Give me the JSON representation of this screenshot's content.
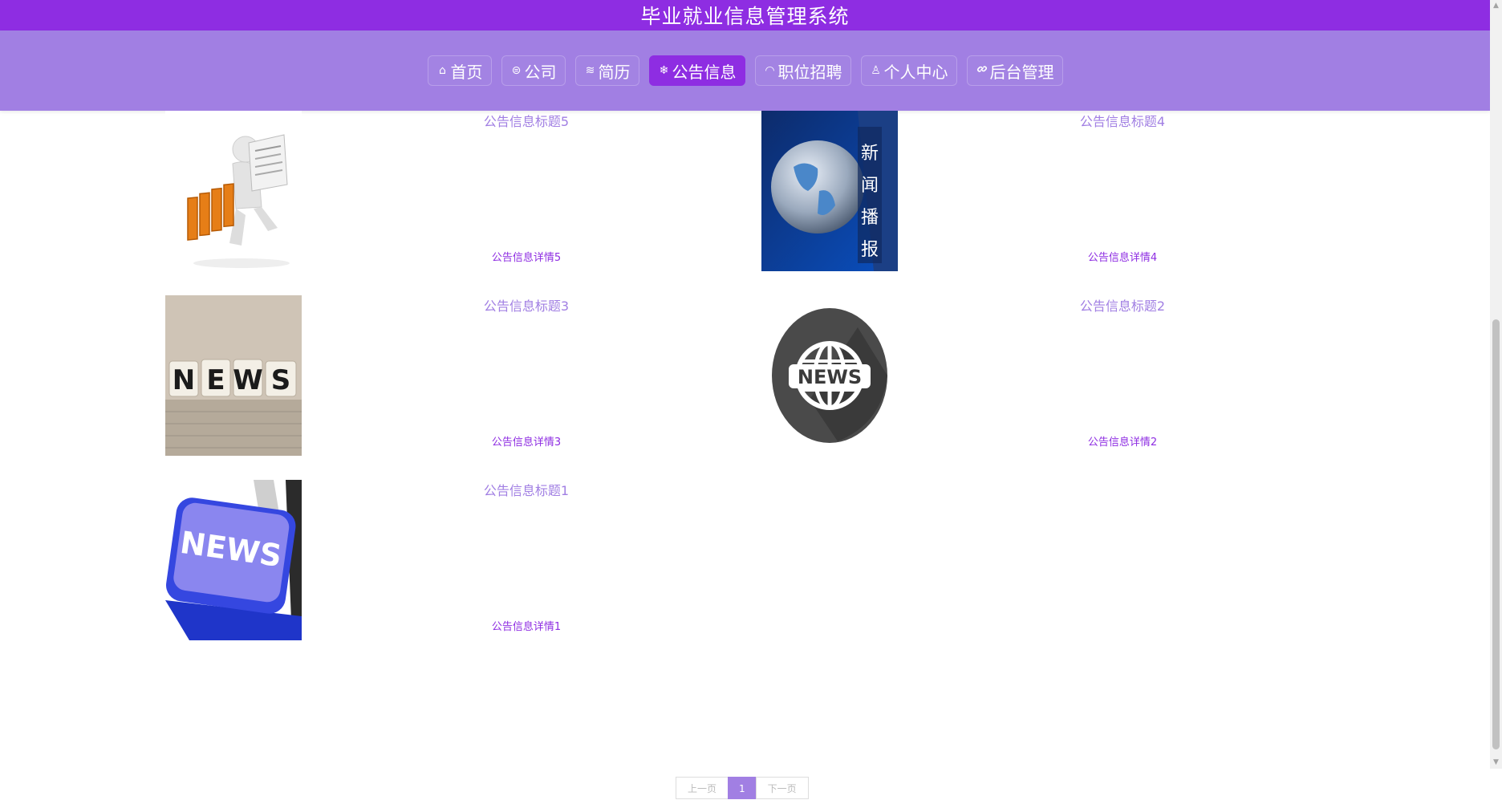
{
  "header": {
    "title": "毕业就业信息管理系统"
  },
  "nav": {
    "items": [
      {
        "icon": "home-icon",
        "glyph": "⌂",
        "label": "首页"
      },
      {
        "icon": "company-icon",
        "glyph": "⊜",
        "label": "公司"
      },
      {
        "icon": "layers-icon",
        "glyph": "≋",
        "label": "简历"
      },
      {
        "icon": "snowflake-icon",
        "glyph": "❄",
        "label": "公告信息",
        "active": true
      },
      {
        "icon": "briefcase-icon",
        "glyph": "◠",
        "label": "职位招聘"
      },
      {
        "icon": "user-icon",
        "glyph": "♙",
        "label": "个人中心"
      },
      {
        "icon": "link-icon",
        "glyph": "🔗",
        "label": "后台管理"
      }
    ]
  },
  "notices": [
    {
      "title": "公告信息标题5",
      "detail": "公告信息详情5",
      "image": "news-reader-image"
    },
    {
      "title": "公告信息标题4",
      "detail": "公告信息详情4",
      "image": "globe-news-image"
    },
    {
      "title": "公告信息标题3",
      "detail": "公告信息详情3",
      "image": "news-blocks-image"
    },
    {
      "title": "公告信息标题2",
      "detail": "公告信息详情2",
      "image": "news-globe-icon-image"
    },
    {
      "title": "公告信息标题1",
      "detail": "公告信息详情1",
      "image": "news-key-image"
    }
  ],
  "pagination": {
    "prev": "上一页",
    "current": "1",
    "next": "下一页"
  },
  "colors": {
    "primary": "#8e2de2",
    "nav_bg": "#a17fe3",
    "title_text": "#a17fe3",
    "detail_text": "#8e2de2"
  }
}
